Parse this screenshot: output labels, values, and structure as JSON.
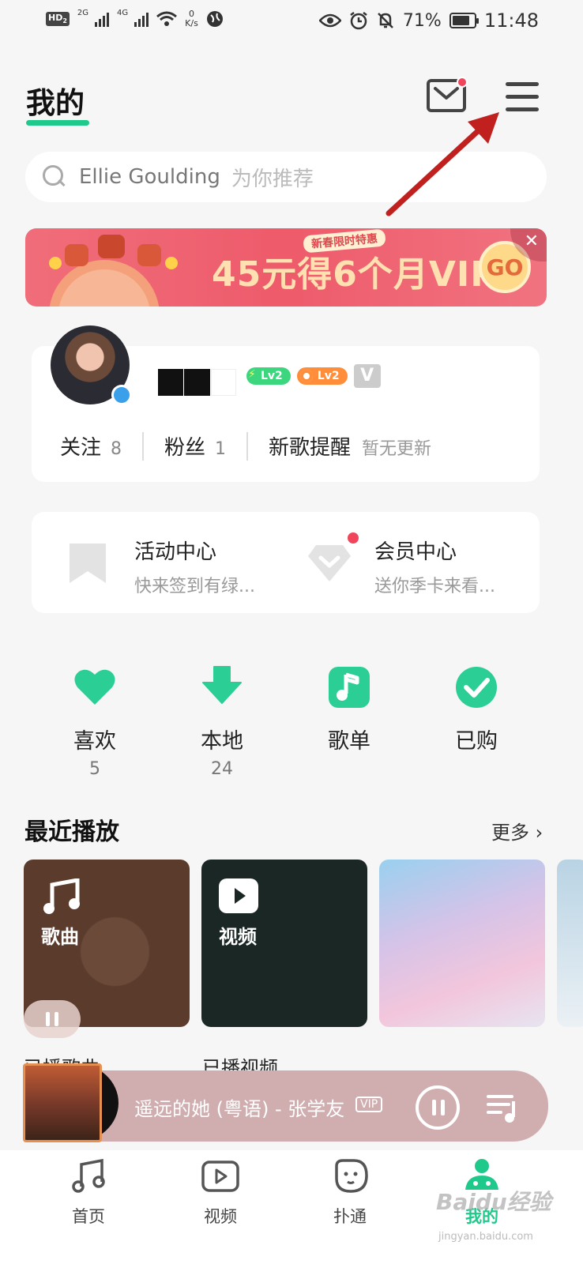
{
  "status_bar": {
    "hd": "HD",
    "hd_sub": "2",
    "sig1": "2G",
    "sig2": "4G",
    "speed_value": "0",
    "speed_unit": "K/s",
    "battery": "71%",
    "time": "11:48"
  },
  "header": {
    "title": "我的"
  },
  "search": {
    "text": "Ellie Goulding",
    "hint": "为你推荐"
  },
  "banner": {
    "tag": "新春限时特惠",
    "text": "45元得6个月VIP",
    "go": "GO",
    "close": "✕"
  },
  "profile": {
    "level_badges": [
      "Lv2",
      "Lv2"
    ],
    "vip_badge": "V",
    "stats": [
      {
        "label": "关注",
        "value": "8"
      },
      {
        "label": "粉丝",
        "value": "1"
      }
    ],
    "new_song": {
      "label": "新歌提醒",
      "hint": "暂无更新"
    }
  },
  "activity": [
    {
      "title": "活动中心",
      "sub": "快来签到有绿..."
    },
    {
      "title": "会员中心",
      "sub": "送你季卡来看..."
    }
  ],
  "quick": [
    {
      "label": "喜欢",
      "count": "5",
      "icon": "heart-icon"
    },
    {
      "label": "本地",
      "count": "24",
      "icon": "download-icon"
    },
    {
      "label": "歌单",
      "count": "",
      "icon": "playlist-icon"
    },
    {
      "label": "已购",
      "count": "",
      "icon": "check-icon"
    }
  ],
  "recent": {
    "title": "最近播放",
    "more": "更多",
    "cards": [
      {
        "label": "歌曲",
        "caption": "已播歌曲"
      },
      {
        "label": "视频",
        "caption": "已播视频"
      }
    ]
  },
  "player": {
    "title": "遥远的她 (粤语) - 张学友",
    "vip": "VIP"
  },
  "nav": [
    {
      "label": "首页",
      "icon": "music-note-icon"
    },
    {
      "label": "视频",
      "icon": "video-icon"
    },
    {
      "label": "扑通",
      "icon": "bubble-icon"
    },
    {
      "label": "我的",
      "icon": "profile-icon"
    }
  ],
  "watermark": {
    "text": "Baidu经验",
    "sub": "jingyan.baidu.com"
  },
  "colors": {
    "accent": "#1fc98b",
    "banner": "#ee5b6b",
    "player": "#d0aeb0",
    "notification_dot": "#f0455a"
  }
}
